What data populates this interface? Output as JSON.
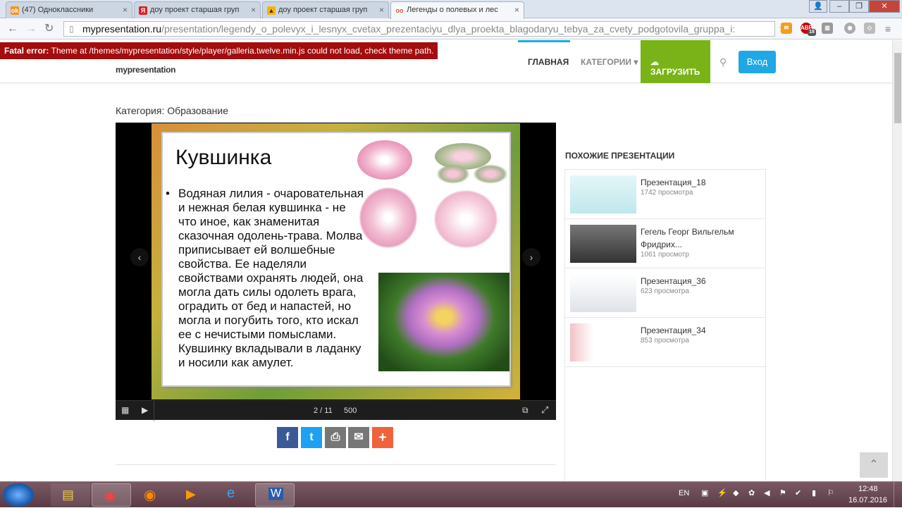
{
  "browser": {
    "tabs": [
      {
        "title": "(47) Одноклассники",
        "favicon_color": "#f7931e",
        "favicon": "ok"
      },
      {
        "title": "доу проект старшая груп",
        "favicon_color": "#e31b23",
        "favicon": "Я"
      },
      {
        "title": "доу проект старшая груп",
        "favicon_color": "#f5b400",
        "favicon": "▲"
      },
      {
        "title": "Легенды о полевых и лес",
        "favicon_color": "#e2463c",
        "favicon": "oo"
      }
    ],
    "url_domain": "mypresentation.ru",
    "url_rest": "/presentation/legendy_o_polevyx_i_lesnyx_cvetax_prezentaciyu_dlya_proekta_blagodaryu_tebya_za_cvety_podgotovila_gruppa_i:",
    "ext_badge": "18",
    "ext_abp": "ABP"
  },
  "site": {
    "fatal_label": "Fatal error:",
    "fatal_text": "Theme at /themes/mypresentation/style/player/galleria.twelve.min.js could not load, check theme path.",
    "logo": "mypresentation",
    "nav_home": "ГЛАВНАЯ",
    "nav_categories": "КАТЕГОРИИ",
    "nav_upload": "ЗАГРУЗИТЬ",
    "nav_login": "Вход",
    "category": "Категория: Образование"
  },
  "slide": {
    "title": "Кувшинка",
    "bullet": "•",
    "body": "Водяная лилия - очаровательная и нежная белая кувшинка - не что иное, как знаменитая сказочная одолень-трава. Молва приписывает ей волшебные свойства. Ее наделяли свойствами охранять людей, она могла дать силы одолеть врага, оградить от бед и напастей, но могла и погубить того, кто искал ее с нечистыми помыслами. Кувшинку вкладывали в ладанку и носили как амулет."
  },
  "player": {
    "counter": "2 / 11",
    "size": "500"
  },
  "similar": {
    "heading": "ПОХОЖИЕ ПРЕЗЕНТАЦИИ",
    "items": [
      {
        "title": "Презентация_18",
        "views": "1742 просмотра"
      },
      {
        "title": "Гегель Георг Вильгельм Фридрих...",
        "views": "1061 просмотр"
      },
      {
        "title": "Презентация_36",
        "views": "623 просмотра"
      },
      {
        "title": "Презентация_34",
        "views": "853 просмотра"
      }
    ]
  },
  "taskbar": {
    "lang": "EN",
    "time": "12:48",
    "date": "16.07.2016"
  }
}
